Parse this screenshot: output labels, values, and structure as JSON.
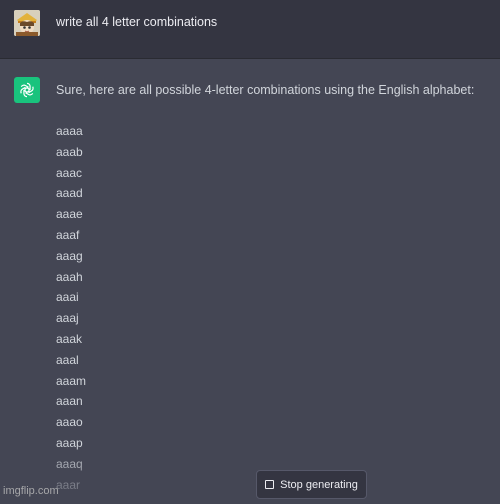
{
  "user_message": {
    "text": "write all 4 letter combinations"
  },
  "assistant_message": {
    "intro": "Sure, here are all possible 4-letter combinations using the English alphabet:",
    "combinations": [
      "aaaa",
      "aaab",
      "aaac",
      "aaad",
      "aaae",
      "aaaf",
      "aaag",
      "aaah",
      "aaai",
      "aaaj",
      "aaak",
      "aaal",
      "aaam",
      "aaan",
      "aaao",
      "aaap",
      "aaaq",
      "aaar"
    ]
  },
  "stop_button": {
    "label": "Stop generating",
    "icon": "stop-square-icon"
  },
  "watermark": {
    "text": "imgflip.com"
  },
  "colors": {
    "user_bg": "#343541",
    "assistant_bg": "#444654",
    "gpt_green": "#19c37d"
  }
}
